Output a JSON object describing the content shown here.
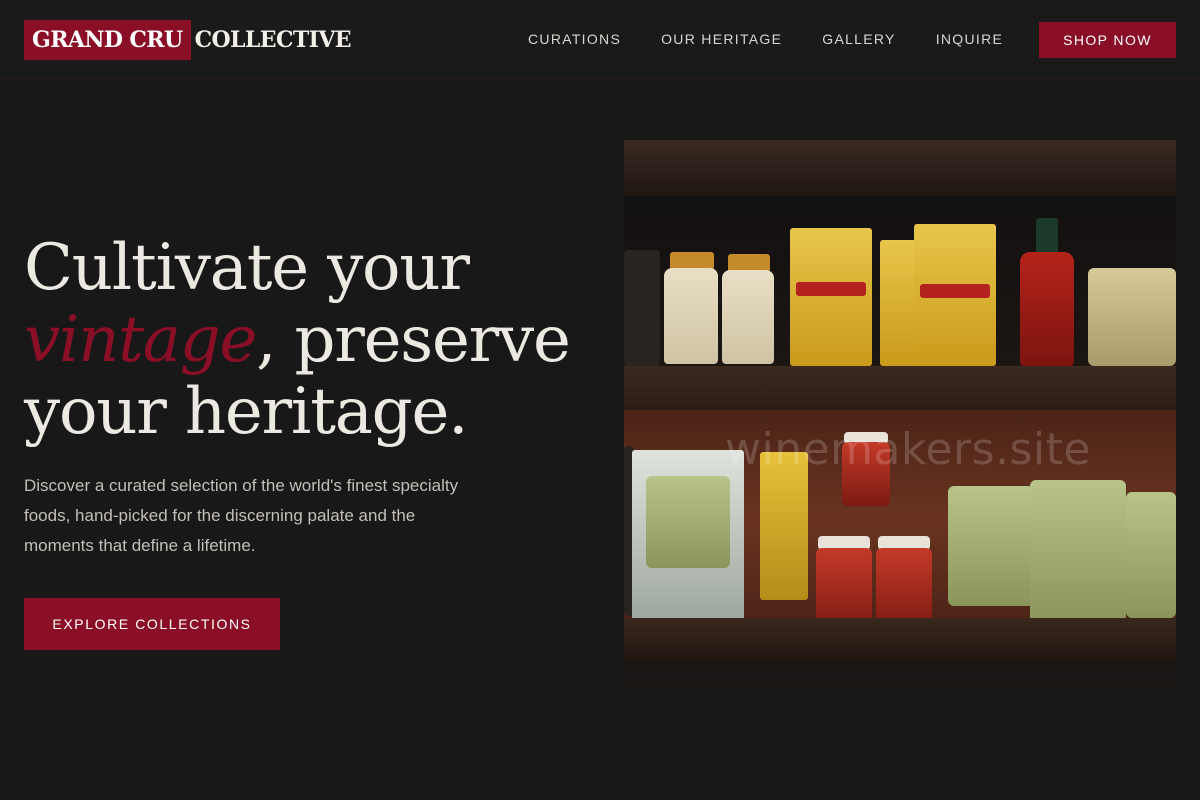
{
  "header": {
    "logo_mark": "GRAND CRU",
    "logo_text": "COLLECTIVE",
    "nav": [
      {
        "label": "CURATIONS"
      },
      {
        "label": "OUR HERITAGE"
      },
      {
        "label": "GALLERY"
      },
      {
        "label": "INQUIRE"
      }
    ],
    "cta_label": "SHOP NOW"
  },
  "hero": {
    "title_line1": "Cultivate your",
    "title_accent": "vintage",
    "title_line2_rest": ", preserve",
    "title_line3": "your heritage.",
    "description": "Discover a curated selection of the world's finest specialty foods, hand-picked for the discerning palate and the moments that define a lifetime.",
    "button_label": "EXPLORE COLLECTIONS",
    "image_watermark": "winemakers.site"
  },
  "colors": {
    "accent": "#8a0f26",
    "background": "#181818",
    "text": "#ece9e3"
  }
}
